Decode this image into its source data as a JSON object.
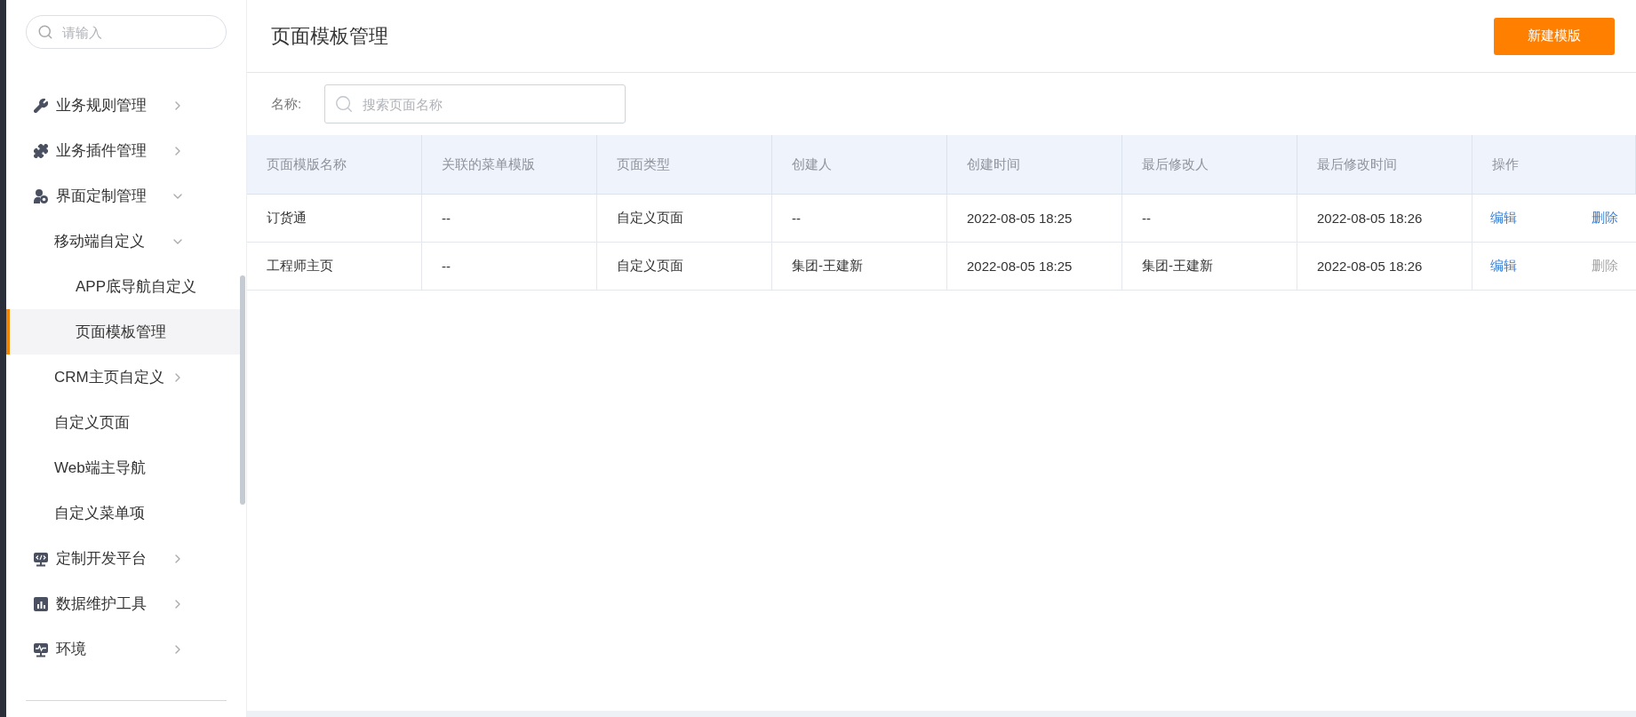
{
  "sidebar": {
    "search": {
      "placeholder": "请输入"
    },
    "items": [
      {
        "label": "业务规则管理",
        "expanded": false,
        "selected": false
      },
      {
        "label": "业务插件管理",
        "expanded": false,
        "selected": false
      },
      {
        "label": "界面定制管理",
        "expanded": true,
        "selected": false,
        "children": [
          {
            "label": "移动端自定义",
            "expanded": true,
            "selected": false,
            "children": [
              {
                "label": "APP底导航自定义",
                "selected": false
              },
              {
                "label": "页面模板管理",
                "selected": true
              }
            ]
          },
          {
            "label": "CRM主页自定义",
            "expanded": false,
            "selected": false
          },
          {
            "label": "自定义页面",
            "selected": false
          },
          {
            "label": "Web端主导航",
            "selected": false
          },
          {
            "label": "自定义菜单项",
            "selected": false
          }
        ]
      },
      {
        "label": "定制开发平台",
        "expanded": false,
        "selected": false
      },
      {
        "label": "数据维护工具",
        "expanded": false,
        "selected": false
      },
      {
        "label": "环境",
        "expanded": false,
        "selected": false
      }
    ]
  },
  "header": {
    "title": "页面模板管理",
    "new_button": "新建模版"
  },
  "filter": {
    "label": "名称:",
    "placeholder": "搜索页面名称"
  },
  "table": {
    "columns": [
      "页面模版名称",
      "关联的菜单模版",
      "页面类型",
      "创建人",
      "创建时间",
      "最后修改人",
      "最后修改时间",
      "操作"
    ],
    "rows": [
      {
        "cells": [
          "订货通",
          "--",
          "自定义页面",
          "--",
          "2022-08-05 18:25",
          "--",
          "2022-08-05 18:26"
        ],
        "actions": [
          {
            "label": "编辑",
            "disabled": false
          },
          {
            "label": "删除",
            "disabled": false
          }
        ]
      },
      {
        "cells": [
          "工程师主页",
          "--",
          "自定义页面",
          "集团-王建新",
          "2022-08-05 18:25",
          "集团-王建新",
          "2022-08-05 18:26"
        ],
        "actions": [
          {
            "label": "编辑",
            "disabled": false
          },
          {
            "label": "删除",
            "disabled": true
          }
        ]
      }
    ]
  }
}
